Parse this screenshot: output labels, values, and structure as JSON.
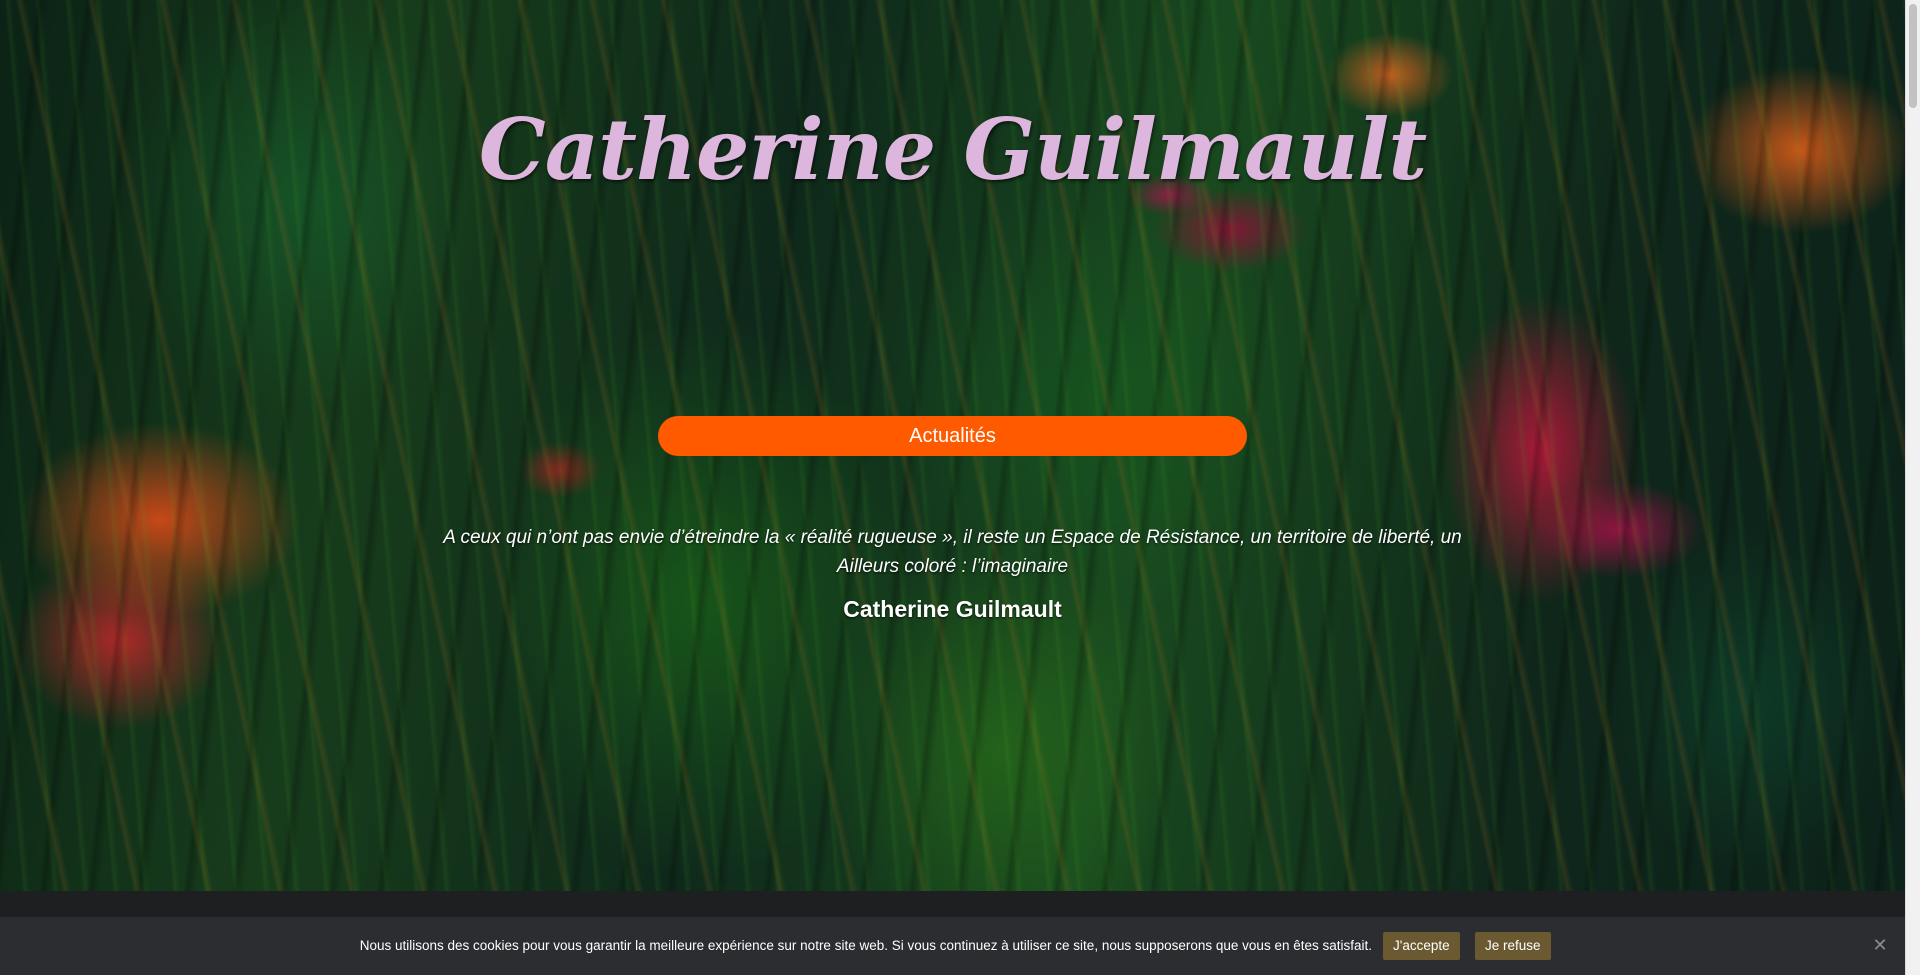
{
  "hero": {
    "site_title": "Catherine Guilmault",
    "news_button": "Actualités",
    "quote": "A ceux qui n’ont pas envie d’étreindre la « réalité rugueuse », il reste un Espace de Résistance, un territoire de liberté, un Ailleurs coloré : l’imaginaire",
    "quote_author": "Catherine Guilmault"
  },
  "cookie_banner": {
    "message": "Nous utilisons des cookies pour vous garantir la meilleure expérience sur notre site web. Si vous continuez à utiliser ce site, nous supposerons que vous en êtes satisfait.",
    "accept_label": "J'accepte",
    "refuse_label": "Je refuse",
    "close_icon": "close-icon"
  },
  "colors": {
    "title": "#dcb6dc",
    "button": "#ff5a00",
    "cookie_bar": "#2b2d30",
    "cookie_button": "#6b5a31"
  }
}
